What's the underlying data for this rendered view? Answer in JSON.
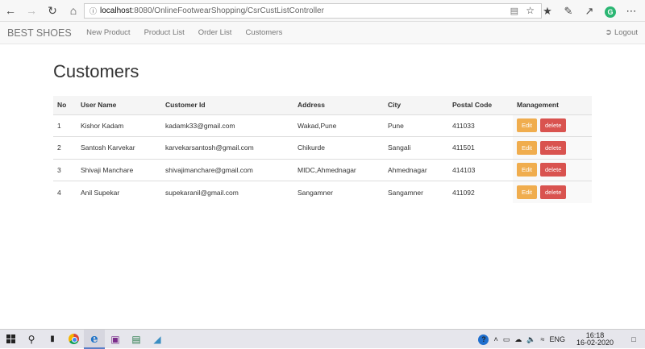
{
  "browser": {
    "url_host": "localhost",
    "url_path": ":8080/OnlineFootwearShopping/CsrCustListController"
  },
  "navbar": {
    "brand": "BEST SHOES",
    "links": [
      "New Product",
      "Product List",
      "Order List",
      "Customers"
    ],
    "logout": "Logout"
  },
  "page": {
    "title": "Customers"
  },
  "table": {
    "headers": [
      "No",
      "User Name",
      "Customer Id",
      "Address",
      "City",
      "Postal Code",
      "Management"
    ],
    "rows": [
      {
        "no": "1",
        "user_name": "Kishor Kadam",
        "customer_id": "kadamk33@gmail.com",
        "address": "Wakad,Pune",
        "city": "Pune",
        "postal_code": "411033"
      },
      {
        "no": "2",
        "user_name": "Santosh Karvekar",
        "customer_id": "karvekarsantosh@gmail.com",
        "address": "Chikurde",
        "city": "Sangali",
        "postal_code": "411501"
      },
      {
        "no": "3",
        "user_name": "Shivaji Manchare",
        "customer_id": "shivajimanchare@gmail.com",
        "address": "MIDC,Ahmednagar",
        "city": "Ahmednagar",
        "postal_code": "414103"
      },
      {
        "no": "4",
        "user_name": "Anil Supekar",
        "customer_id": "supekaranil@gmail.com",
        "address": "Sangamner",
        "city": "Sangamner",
        "postal_code": "411092"
      }
    ],
    "edit_label": "Edit",
    "delete_label": "delete"
  },
  "taskbar": {
    "language": "ENG",
    "time": "16:18",
    "date": "16-02-2020"
  },
  "colors": {
    "edit": "#f0ad4e",
    "delete": "#d9534f"
  }
}
